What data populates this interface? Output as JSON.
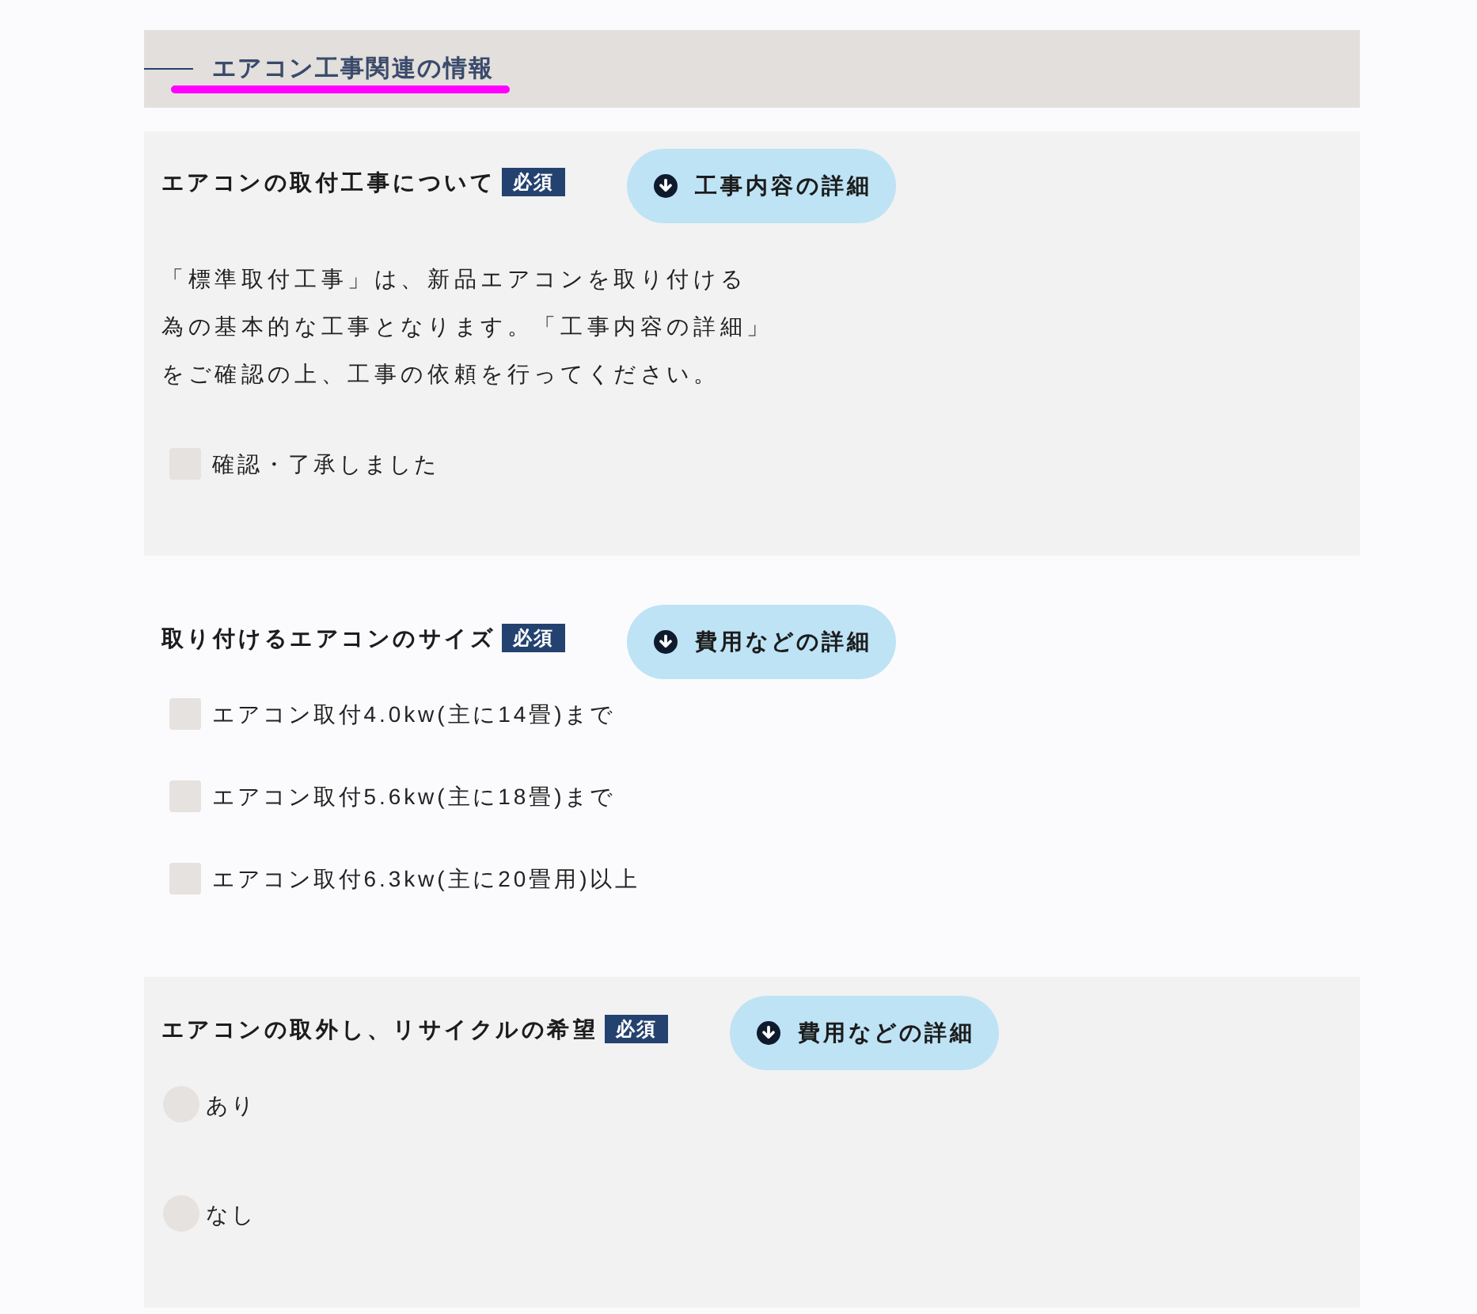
{
  "section_header": {
    "title": "エアコン工事関連の情報"
  },
  "sections": [
    {
      "title": "エアコンの取付工事について",
      "badge": "必須",
      "button": {
        "label": "工事内容の詳細"
      },
      "description": [
        "「標準取付工事」は、新品エアコンを取り付ける",
        "為の基本的な工事となります。「工事内容の詳細」",
        "をご確認の上、工事の依頼を行ってください。"
      ],
      "options": [
        {
          "kind": "checkbox",
          "label": "確認・了承しました",
          "checked": false
        }
      ]
    },
    {
      "title": "取り付けるエアコンのサイズ",
      "badge": "必須",
      "button": {
        "label": "費用などの詳細"
      },
      "options": [
        {
          "kind": "checkbox",
          "label": "エアコン取付4.0kw(主に14畳)まで",
          "checked": false
        },
        {
          "kind": "checkbox",
          "label": "エアコン取付5.6kw(主に18畳)まで",
          "checked": false
        },
        {
          "kind": "checkbox",
          "label": "エアコン取付6.3kw(主に20畳用)以上",
          "checked": false
        }
      ]
    },
    {
      "title": "エアコンの取外し、リサイクルの希望",
      "badge": "必須",
      "button": {
        "label": "費用などの詳細"
      },
      "options": [
        {
          "kind": "radio",
          "label": "あり",
          "selected": false
        },
        {
          "kind": "radio",
          "label": "なし",
          "selected": false
        }
      ]
    }
  ]
}
